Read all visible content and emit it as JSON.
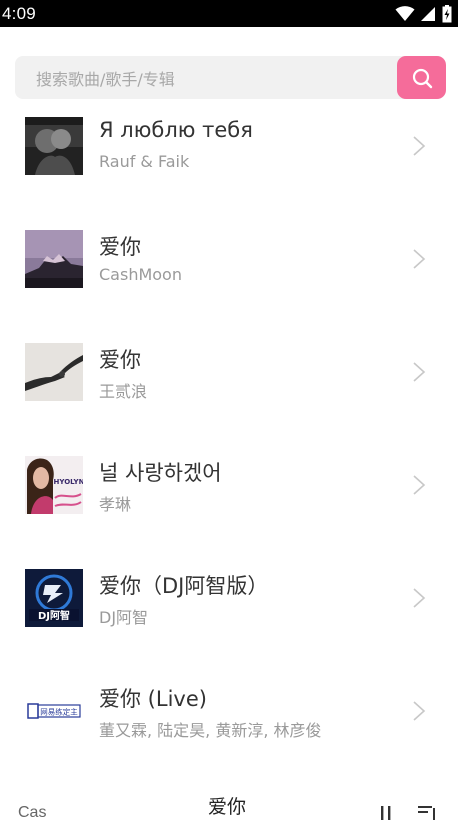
{
  "status": {
    "time": "4:09"
  },
  "search": {
    "placeholder": "搜索歌曲/歌手/专辑"
  },
  "songs": [
    {
      "title": "Я люблю тебя",
      "artist": "Rauf & Faik"
    },
    {
      "title": "爱你",
      "artist": "CashMoon"
    },
    {
      "title": "爱你",
      "artist": "王贰浪"
    },
    {
      "title": "널 사랑하겠어",
      "artist": "孝琳"
    },
    {
      "title": "爱你（DJ阿智版）",
      "artist": "DJ阿智"
    },
    {
      "title": "爱你 (Live)",
      "artist": "董又霖, 陆定昊, 黄新淳, 林彦俊"
    }
  ],
  "covers": {
    "cover_3_text": "HYOLYN",
    "cover_4_text": "DJ阿智",
    "cover_5_text": "网易练定主"
  },
  "player": {
    "artist": "Cas",
    "title": "爱你"
  },
  "colors": {
    "accent": "#f56c9a"
  }
}
